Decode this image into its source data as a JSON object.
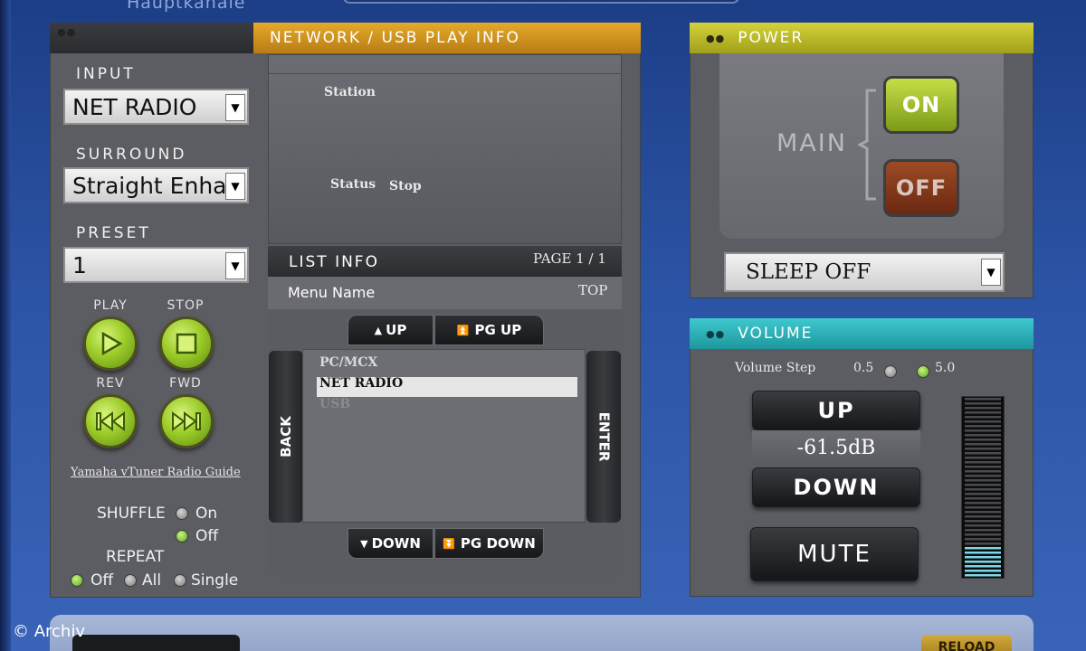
{
  "top": {
    "title": "Hauptkanäle"
  },
  "left": {
    "input_label": "INPUT",
    "input_value": "NET RADIO",
    "surround_label": "SURROUND",
    "surround_value": "Straight Enha",
    "preset_label": "PRESET",
    "preset_value": "1",
    "controls": {
      "play": "PLAY",
      "stop": "STOP",
      "rev": "REV",
      "fwd": "FWD"
    },
    "guide_link": "Yamaha vTuner Radio Guide",
    "shuffle_label": "SHUFFLE",
    "shuffle_on": "On",
    "shuffle_off": "Off",
    "shuffle_selected": "Off",
    "repeat_label": "REPEAT",
    "repeat_off": "Off",
    "repeat_all": "All",
    "repeat_single": "Single",
    "repeat_selected": "Off"
  },
  "network": {
    "header": "NETWORK / USB PLAY INFO",
    "station_label": "Station",
    "station_value": "",
    "status_label": "Status",
    "status_value": "Stop"
  },
  "list": {
    "header": "LIST INFO",
    "page": "PAGE 1 / 1",
    "menu_name": "Menu Name",
    "top": "TOP",
    "up": "UP",
    "pg_up": "PG UP",
    "down": "DOWN",
    "pg_down": "PG DOWN",
    "back": "BACK",
    "enter": "ENTER",
    "items": [
      "PC/MCX",
      "NET RADIO",
      "USB"
    ],
    "selected_item": "NET RADIO"
  },
  "power": {
    "header": "POWER",
    "main_label": "MAIN",
    "on": "ON",
    "off": "OFF",
    "sleep_value": "SLEEP OFF"
  },
  "volume": {
    "header": "VOLUME",
    "step_label": "Volume Step",
    "step_a": "0.5",
    "step_b": "5.0",
    "step_selected": "5.0",
    "up": "UP",
    "level": "-61.5dB",
    "down": "DOWN",
    "mute": "MUTE",
    "meter_fraction": 0.18
  },
  "footer": {
    "credit": "© Archiv",
    "reload": "RELOAD"
  },
  "colors": {
    "net_header": "#e6a92a",
    "power_header": "#d4d23a",
    "volume_header": "#3fc8cf",
    "meter_active": "#7ad8ea"
  },
  "icons": {
    "play": "play-icon",
    "stop": "stop-icon",
    "rev": "rewind-icon",
    "fwd": "fast-forward-icon"
  }
}
